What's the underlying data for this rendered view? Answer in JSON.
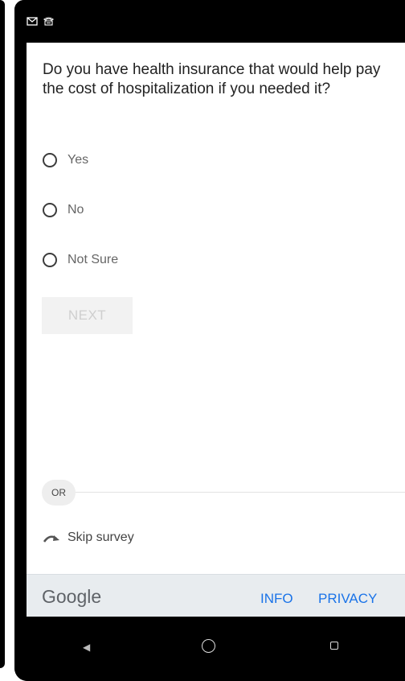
{
  "survey": {
    "question": "Do you have health insurance that would help pay the cost of hospitalization if you needed it?",
    "options": [
      {
        "label": "Yes"
      },
      {
        "label": "No"
      },
      {
        "label": "Not Sure"
      }
    ],
    "next_label": "NEXT",
    "or_label": "OR",
    "skip_label": "Skip survey"
  },
  "footer": {
    "brand": "Google",
    "info_label": "INFO",
    "privacy_label": "PRIVACY"
  },
  "colors": {
    "link": "#1a73e8",
    "footer_bg": "#e8ecef"
  },
  "status_icons": [
    "mail-icon",
    "voicemail-icon"
  ]
}
